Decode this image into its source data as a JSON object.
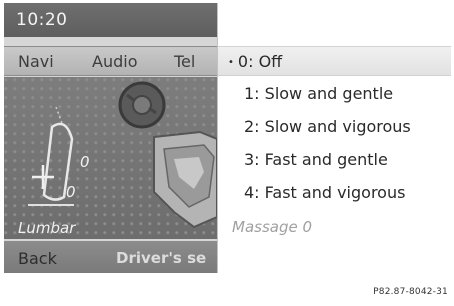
{
  "status": {
    "time": "10:20"
  },
  "nav": {
    "items": [
      "Navi",
      "Audio",
      "Tel"
    ]
  },
  "seat": {
    "lumbar_label": "Lumbar",
    "lumbar_values": [
      "0",
      "0"
    ],
    "back_label": "Back",
    "drivers_seat_label": "Driver's se"
  },
  "menu": {
    "items": [
      {
        "label": "0: Off",
        "selected": true
      },
      {
        "label": "1: Slow and gentle",
        "selected": false
      },
      {
        "label": "2: Slow and vigorous",
        "selected": false
      },
      {
        "label": "3: Fast and gentle",
        "selected": false
      },
      {
        "label": "4: Fast and vigorous",
        "selected": false
      }
    ],
    "bullet": "•",
    "footer": "Massage  0"
  },
  "photo_ref": "P82.87-8042-31",
  "colors": {
    "menu_bg": "#ffffff",
    "panel_dark": "#6e6e6e",
    "highlight": "#e6e6e6"
  }
}
